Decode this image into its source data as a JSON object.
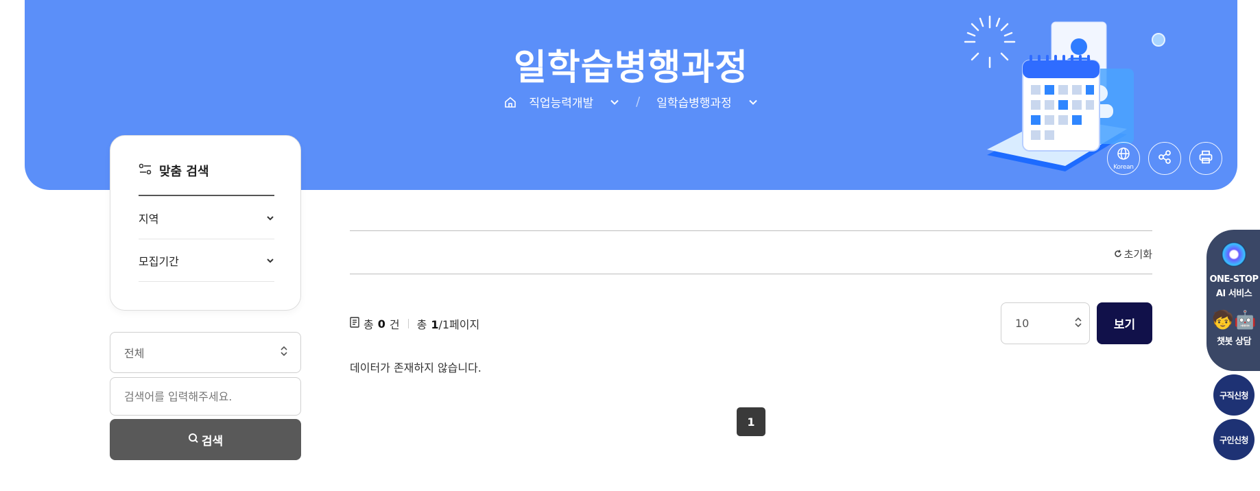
{
  "banner": {
    "title": "일학습병행과정",
    "breadcrumb": {
      "home_icon": "home-icon",
      "level1": "직업능력개발",
      "level2": "일학습병행과정"
    },
    "tools": {
      "language_label": "Korean",
      "share_icon": "share-icon",
      "print_icon": "print-icon"
    },
    "colors": {
      "background": "#5b8ff9"
    }
  },
  "custom_search": {
    "title": "맞춤 검색",
    "filters": [
      {
        "label": "지역"
      },
      {
        "label": "모집기간"
      }
    ]
  },
  "search": {
    "category_selected": "전체",
    "keyword_placeholder": "검색어를 입력해주세요.",
    "button_label": "검색"
  },
  "results": {
    "reset_label": "초기화",
    "summary": {
      "total_prefix": "총",
      "total_count": "0",
      "total_unit": "건",
      "page_prefix": "총",
      "current_page": "1",
      "page_suffix": "/1페이지"
    },
    "per_page_selected": "10",
    "view_button": "보기",
    "empty_message": "데이터가 존재하지 않습니다.",
    "pagination": [
      "1"
    ]
  },
  "floating": {
    "ai_line1": "ONE-STOP",
    "ai_line2": "AI 서비스",
    "chatbot_label": "챗봇 상담",
    "job_seek_label": "구직신청",
    "job_offer_label": "구인신청",
    "colors": {
      "panel": "#3a4766",
      "circle": "#1e3274"
    }
  }
}
